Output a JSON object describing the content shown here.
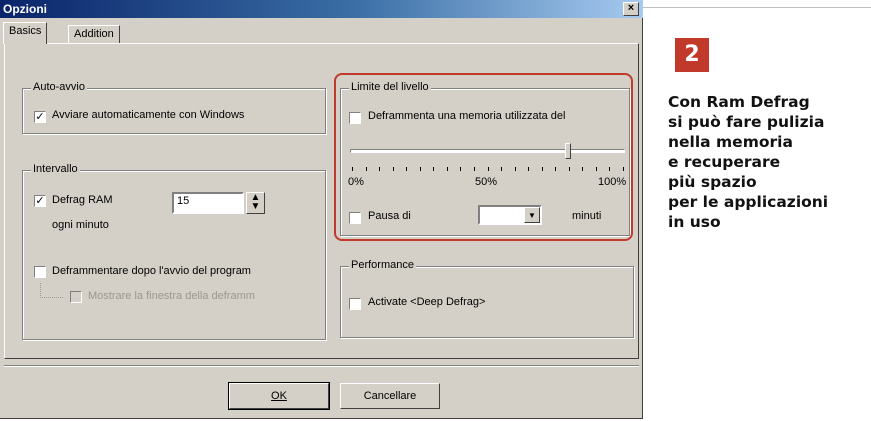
{
  "window": {
    "title": "Opzioni",
    "close_glyph": "×",
    "tabs": [
      {
        "label": "Basics",
        "active": true
      },
      {
        "label": "Addition",
        "active": false
      }
    ]
  },
  "auto_avvio": {
    "title": "Auto-avvio",
    "checkbox_label": "Avviare automaticamente con Windows",
    "checked": true
  },
  "intervallo": {
    "title": "Intervallo",
    "defrag_label": "Defrag RAM",
    "defrag_checked": true,
    "value": "15",
    "unit": "ogni minuto",
    "after_start_label": "Deframmentare dopo l'avvio del program",
    "after_start_checked": false,
    "show_window_label": "Mostrare la finestra della deframm",
    "show_window_checked": false
  },
  "limite": {
    "title": "Limite del livello",
    "defrag_mem_label": "Deframmenta una memoria utilizzata del",
    "defrag_mem_checked": false,
    "slider_value_percent": 80,
    "scale": [
      "0%",
      "50%",
      "100%"
    ],
    "pause_label": "Pausa di",
    "pause_checked": false,
    "pause_value": "",
    "pause_unit": "minuti"
  },
  "performance": {
    "title": "Performance",
    "deep_label": "Activate <Deep Defrag>",
    "deep_checked": false
  },
  "buttons": {
    "ok": "OK",
    "cancel": "Cancellare"
  },
  "annotation": {
    "number": "2",
    "accent_color": "#c0392b",
    "lines": [
      "Con Ram Defrag",
      "si può fare pulizia",
      "nella memoria",
      "e recuperare",
      "più spazio",
      "per le applicazioni",
      "in uso"
    ]
  }
}
